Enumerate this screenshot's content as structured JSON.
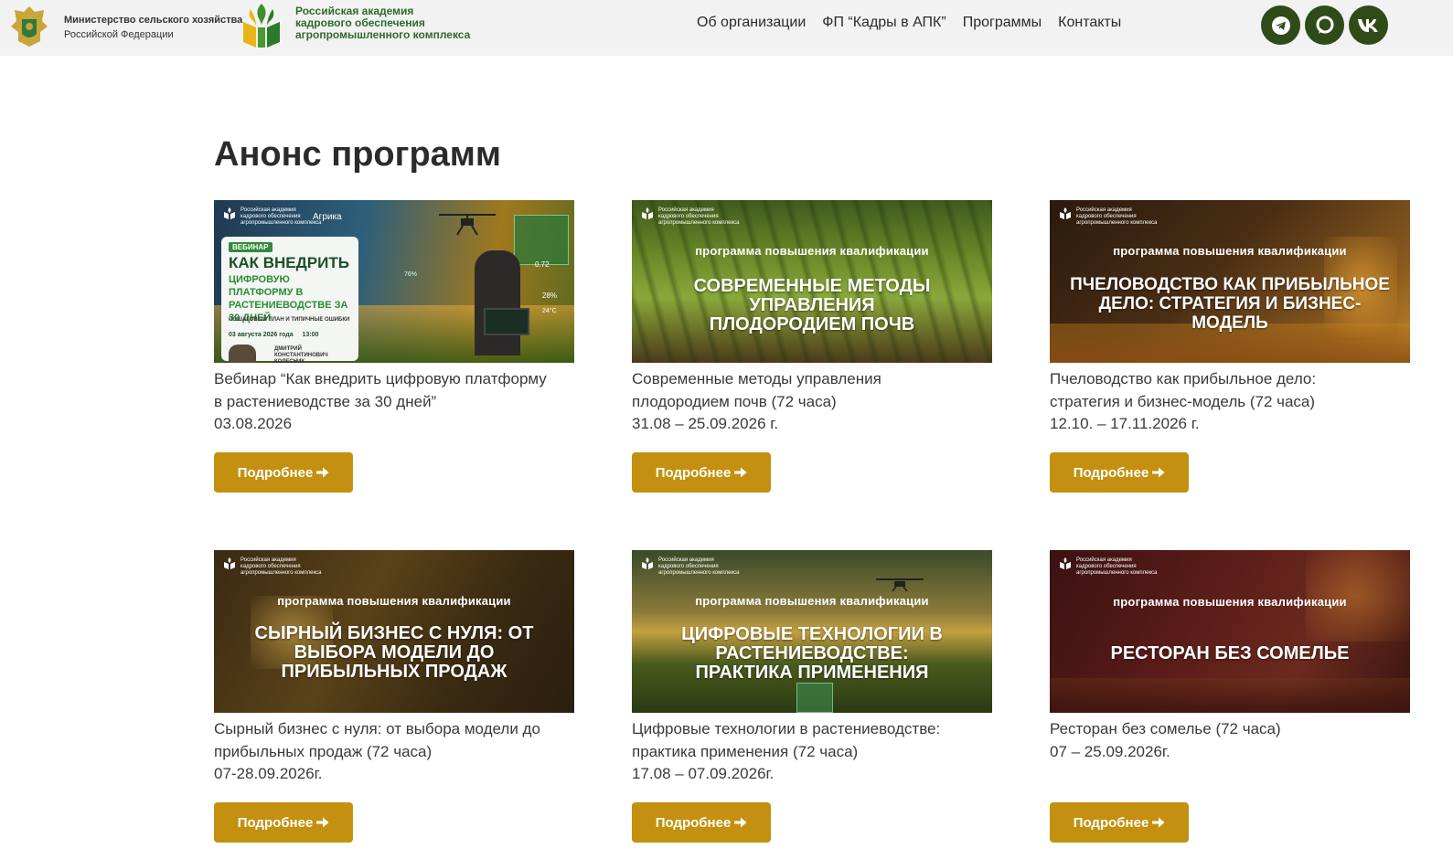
{
  "header": {
    "ministry_line1": "Министерство сельского хозяйства",
    "ministry_line2": "Российской Федерации",
    "academy_line1": "Российская академия",
    "academy_line2": "кадрового обеспечения",
    "academy_line3": "агропромышленного комплекса",
    "nav": [
      {
        "label": "Об организации"
      },
      {
        "label": "ФП “Кадры в АПК”"
      },
      {
        "label": "Программы"
      },
      {
        "label": "Контакты"
      }
    ],
    "social_icons": [
      "telegram-icon",
      "chat-icon",
      "vk-icon"
    ],
    "social_color": "#2e4b18"
  },
  "main": {
    "title": "Анонс программ",
    "button_label": "Подробнее",
    "button_color": "#c4900f",
    "banner_logo_text": "Российская академия кадрового обеспечения агропромышленного комплекса",
    "banner_kicker": "программа повышения квалификации",
    "cards": [
      {
        "banner": {
          "badge": "ВЕБИНАР",
          "partner": "Агрика",
          "headline_1": "КАК ВНЕДРИТЬ",
          "headline_2": "ЦИФРОВУЮ ПЛАТФОРМУ В РАСТЕНИЕВОДСТВЕ ЗА 30 ДНЕЙ",
          "subline": "ПОШАГОВЫЙ ПЛАН И ТИПИЧНЫЕ ОШИБКИ",
          "date": "03 августа 2026 года",
          "time": "13:00",
          "speaker": "ДМИТРИЙ КОНСТАНТИНОВИЧ КОЛЕСНИК",
          "stat_1": "0.72",
          "stat_2": "28%",
          "stat_3": "24°C",
          "stat_4": "76%"
        },
        "title_1": "Вебинар “Как внедрить цифровую платформу",
        "title_2": "в растениеводстве за 30 дней”",
        "dates": "03.08.2026"
      },
      {
        "banner": {
          "headline": "СОВРЕМЕННЫЕ МЕТОДЫ УПРАВЛЕНИЯ ПЛОДОРОДИЕМ ПОЧВ"
        },
        "title_1": "Современные методы управления",
        "title_2": "плодородием почв (72 часа)",
        "dates": "31.08 – 25.09.2026 г."
      },
      {
        "banner": {
          "headline": "ПЧЕЛОВОДСТВО КАК ПРИБЫЛЬНОЕ ДЕЛО: СТРАТЕГИЯ И БИЗНЕС-МОДЕЛЬ"
        },
        "title_1": "Пчеловодство как прибыльное дело:",
        "title_2": "стратегия и бизнес-модель (72 часа)",
        "dates": "12.10. – 17.11.2026 г."
      },
      {
        "banner": {
          "headline": "СЫРНЫЙ БИЗНЕС С НУЛЯ: ОТ ВЫБОРА МОДЕЛИ ДО ПРИБЫЛЬНЫХ ПРОДАЖ"
        },
        "title_1": "Сырный бизнес с нуля: от выбора модели до",
        "title_2": "прибыльных продаж (72 часа)",
        "dates": "07-28.09.2026г."
      },
      {
        "banner": {
          "headline": "ЦИФРОВЫЕ ТЕХНОЛОГИИ В РАСТЕНИЕВОДСТВЕ: ПРАКТИКА ПРИМЕНЕНИЯ"
        },
        "title_1": "Цифровые технологии в растениеводстве:",
        "title_2": "практика применения (72 часа)",
        "dates": "17.08 – 07.09.2026г."
      },
      {
        "banner": {
          "headline": "РЕСТОРАН БЕЗ СОМЕЛЬЕ"
        },
        "title_1": "Ресторан без сомелье (72 часа)",
        "title_2": "07 – 25.09.2026г.",
        "dates": ""
      }
    ]
  }
}
